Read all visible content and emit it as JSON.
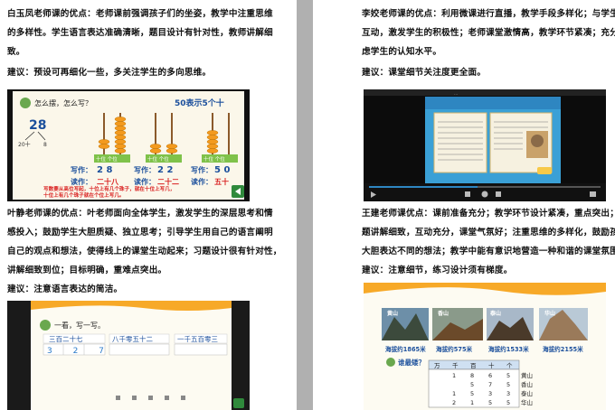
{
  "left": {
    "para1": {
      "lines": [
        "白玉凤老师课的优点：老师课前强调孩子们的坐姿，教学中注重思维",
        "的多样性。学生语言表达准确清晰，题目设计有针对性，教师讲解细",
        "致。"
      ],
      "suggestion": "建议：预设可再细化一些，多关注学生的多向思维。"
    },
    "slide1": {
      "question": "怎么摆，怎么写？",
      "right_title": "50表示5个十",
      "number": "28",
      "split_left": "20十",
      "split_right": "8",
      "abacus_label": "十位 个位",
      "write_label_1": "写作：",
      "write_value_1": "2 8",
      "read_label_1": "读作：",
      "read_value_1": "二十八",
      "write_label_2": "写作：",
      "write_value_2": "2 2",
      "read_label_2": "读作：",
      "read_value_2": "二十二",
      "write_label_3": "写作：",
      "write_value_3": "5 0",
      "read_label_3": "读作：",
      "read_value_3": "五十",
      "rule_line_1": "写数要从高位写起，十位上有几个珠子，就在十位上写几，",
      "rule_line_2": "十位上有几个珠子就在个位上写几。"
    },
    "para2": {
      "lines": [
        "叶静老师课的优点：叶老师面向全体学生，激发学生的深层思考和情",
        "感投入；鼓励学生大胆质疑、独立思考；引导学生用自己的语言阐明",
        "自己的观点和想法，使得线上的课堂生动起来；习题设计很有针对性，",
        "讲解细致到位；目标明确，重难点突出。"
      ],
      "suggestion": "建议：注意语言表达的简洁。"
    },
    "slide3": {
      "prompt": "一看，写一写。",
      "item1": "三百二十七",
      "item1_answer": "3 2 7",
      "item2": "八千零五十二",
      "item3": "一千五百零三"
    }
  },
  "right": {
    "para1": {
      "lines": [
        "李姣老师课的优点：利用微课进行直播，教学手段多样化；与学生的",
        "互动，激发学生的积极性；老师课堂激情高，教学环节紧凑；充分考",
        "虑学生的认知水平。"
      ],
      "suggestion": "建议：课堂细节关注度更全面。"
    },
    "slide2": {
      "player_title": "..."
    },
    "para2": {
      "lines": [
        "王建老师课优点：课前准备充分；教学环节设计紧凑，重点突出；习",
        "题讲解细致，互动充分，课堂气氛好；注重思维的多样化，鼓励孩子",
        "大胆表达不同的想法；教学中能有意识地营造一种和谐的课堂氛围。"
      ],
      "suggestion": "建议：注意细节，练习设计须有梯度。"
    },
    "slide4": {
      "mountains": [
        "黄山",
        "香山",
        "泰山",
        "华山"
      ],
      "altitudes": [
        "海拔约1865米",
        "海拔约575米",
        "海拔约1533米",
        "海拔约2155米"
      ],
      "question": "谁最矮？",
      "table_header": [
        "万",
        "千",
        "百",
        "十",
        "个"
      ],
      "table_rows": [
        [
          "1",
          "8",
          "6",
          "5",
          "黄山"
        ],
        [
          "",
          "5",
          "7",
          "5",
          "香山"
        ],
        [
          "1",
          "5",
          "3",
          "3",
          "泰山"
        ],
        [
          "2",
          "1",
          "5",
          "5",
          "华山"
        ]
      ]
    }
  },
  "colors": {
    "text": "#111111",
    "blue_text": "#1b4f9c",
    "slide_orange": "#f39a1e",
    "slide_green": "#2f8a3c",
    "slide_red": "#d92020",
    "gutter": "#b0b0b0"
  }
}
